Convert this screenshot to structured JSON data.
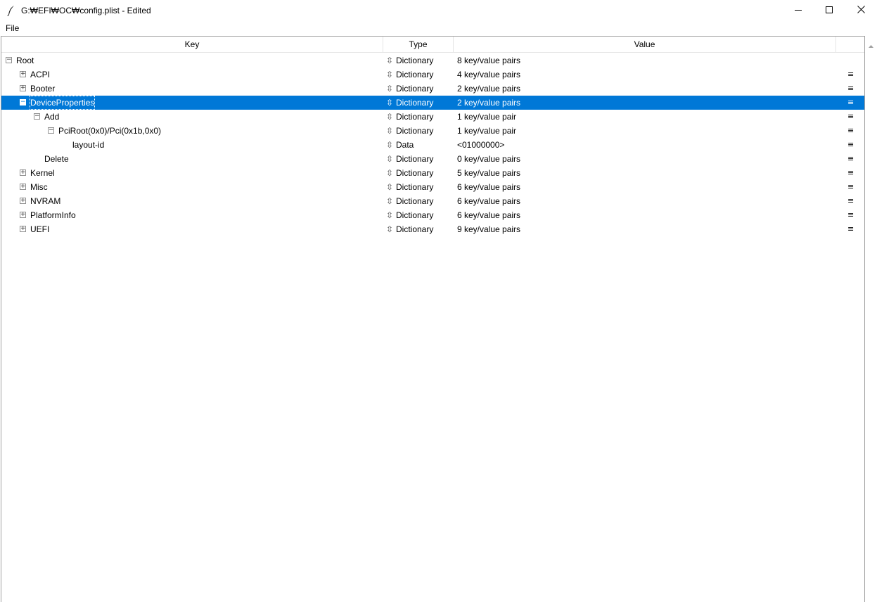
{
  "window": {
    "title": "G:₩EFI₩OC₩config.plist - Edited",
    "icons": {
      "app": "feather-icon",
      "minimize": "minimize-icon",
      "maximize": "maximize-icon",
      "close": "close-icon"
    }
  },
  "menu": {
    "file": "File"
  },
  "columns": {
    "key": "Key",
    "type": "Type",
    "value": "Value"
  },
  "glyphs": {
    "collapse": "−",
    "expand": "+",
    "type_arrow": "⇳",
    "row_menu": "≡"
  },
  "colors": {
    "selection": "#0078d7",
    "header_divider": "#e5e5e5",
    "frame_border": "#a0a0a0"
  },
  "rows": [
    {
      "key": "Root",
      "type": "Dictionary",
      "value": "8 key/value pairs",
      "depth": 0,
      "state": "expanded",
      "row_menu": false,
      "selected": false
    },
    {
      "key": "ACPI",
      "type": "Dictionary",
      "value": "4 key/value pairs",
      "depth": 1,
      "state": "collapsed",
      "row_menu": true,
      "selected": false
    },
    {
      "key": "Booter",
      "type": "Dictionary",
      "value": "2 key/value pairs",
      "depth": 1,
      "state": "collapsed",
      "row_menu": true,
      "selected": false
    },
    {
      "key": "DeviceProperties",
      "type": "Dictionary",
      "value": "2 key/value pairs",
      "depth": 1,
      "state": "expanded",
      "row_menu": true,
      "selected": true
    },
    {
      "key": "Add",
      "type": "Dictionary",
      "value": "1 key/value pair",
      "depth": 2,
      "state": "expanded",
      "row_menu": true,
      "selected": false
    },
    {
      "key": "PciRoot(0x0)/Pci(0x1b,0x0)",
      "type": "Dictionary",
      "value": "1 key/value pair",
      "depth": 3,
      "state": "expanded",
      "row_menu": true,
      "selected": false
    },
    {
      "key": "layout-id",
      "type": "Data",
      "value": "<01000000>",
      "depth": 4,
      "state": "leaf",
      "row_menu": true,
      "selected": false
    },
    {
      "key": "Delete",
      "type": "Dictionary",
      "value": "0 key/value pairs",
      "depth": 2,
      "state": "leaf",
      "row_menu": true,
      "selected": false
    },
    {
      "key": "Kernel",
      "type": "Dictionary",
      "value": "5 key/value pairs",
      "depth": 1,
      "state": "collapsed",
      "row_menu": true,
      "selected": false
    },
    {
      "key": "Misc",
      "type": "Dictionary",
      "value": "6 key/value pairs",
      "depth": 1,
      "state": "collapsed",
      "row_menu": true,
      "selected": false
    },
    {
      "key": "NVRAM",
      "type": "Dictionary",
      "value": "6 key/value pairs",
      "depth": 1,
      "state": "collapsed",
      "row_menu": true,
      "selected": false
    },
    {
      "key": "PlatformInfo",
      "type": "Dictionary",
      "value": "6 key/value pairs",
      "depth": 1,
      "state": "collapsed",
      "row_menu": true,
      "selected": false
    },
    {
      "key": "UEFI",
      "type": "Dictionary",
      "value": "9 key/value pairs",
      "depth": 1,
      "state": "collapsed",
      "row_menu": true,
      "selected": false
    }
  ]
}
